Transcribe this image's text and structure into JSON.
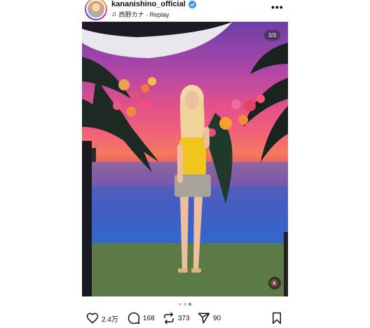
{
  "post": {
    "username": "kananishino_official",
    "audio": "西野カナ · Replay",
    "counter": "3/3",
    "likes": "2.4万",
    "comments": "168",
    "reposts": "373",
    "shares": "90"
  },
  "icons": {
    "verified": "verified-badge-icon",
    "audio": "music-note-icon",
    "more": "more-horizontal-icon",
    "mute": "mute-icon",
    "like": "heart-icon",
    "comment": "comment-icon",
    "repost": "repost-icon",
    "share": "share-icon",
    "save": "bookmark-icon"
  },
  "colors": {
    "verified": "#3897f0",
    "active_dot": "#3897f0"
  }
}
